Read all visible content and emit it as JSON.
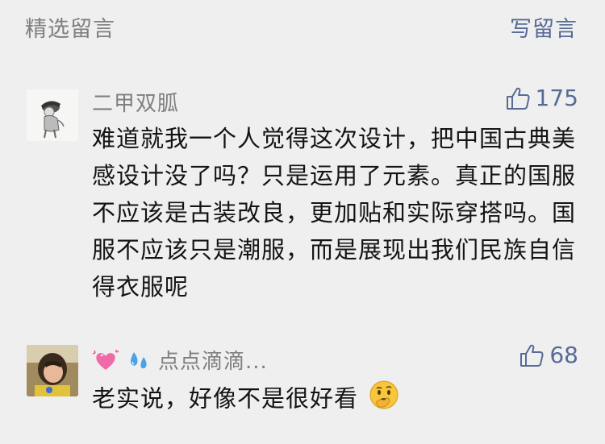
{
  "header": {
    "title": "精选留言",
    "write_label": "写留言"
  },
  "comments": [
    {
      "nickname": "二甲双胍",
      "likes": "175",
      "content": "难道就我一个人觉得这次设计，把中国古典美感设计没了吗？只是运用了元素。真正的国服不应该是古装改良，更加贴和实际穿搭吗。国服不应该只是潮服，而是展现出我们民族自信得衣服呢"
    },
    {
      "nickname_emojis": [
        "sparkling-heart-emoji",
        "sweat-droplets-emoji"
      ],
      "nickname": "点点滴滴...",
      "likes": "68",
      "content": "老实说，好像不是很好看",
      "content_emoji": "thinking-face-emoji"
    }
  ],
  "colors": {
    "background": "#efefef",
    "link": "#576b95",
    "muted": "#7f7f7f",
    "text": "#141414"
  }
}
